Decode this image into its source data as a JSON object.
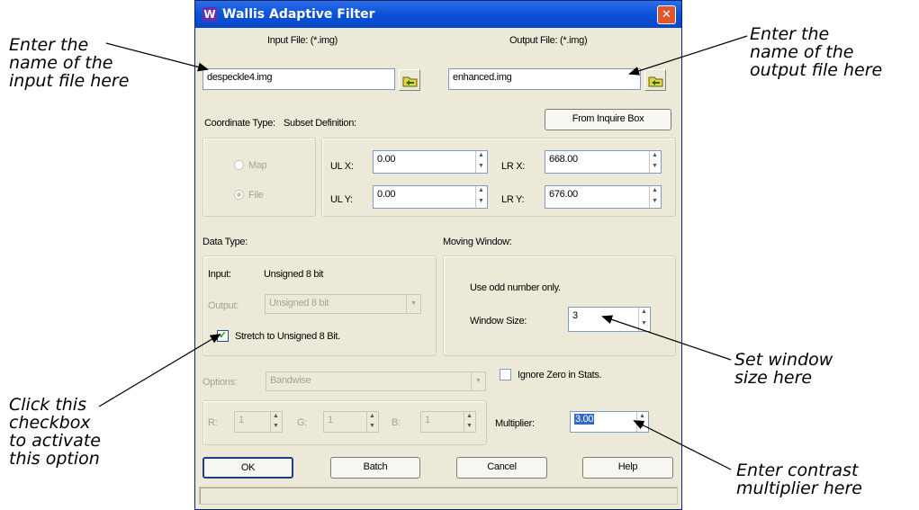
{
  "window": {
    "title": "Wallis Adaptive Filter",
    "close": "✕",
    "icon": "W"
  },
  "input": {
    "label": "Input File: (*.img)",
    "value": "despeckle4.img"
  },
  "output": {
    "label": "Output File: (*.img)",
    "value": "enhanced.img"
  },
  "coordinate": {
    "label": "Coordinate Type:",
    "map": "Map",
    "file": "File"
  },
  "subset": {
    "label": "Subset Definition:",
    "from_inquire": "From Inquire Box",
    "ulx_label": "UL X:",
    "ulx": "0.00",
    "uly_label": "UL Y:",
    "uly": "0.00",
    "lrx_label": "LR X:",
    "lrx": "668.00",
    "lry_label": "LR Y:",
    "lry": "676.00"
  },
  "data_type": {
    "label": "Data Type:",
    "input_label": "Input:",
    "input_value": "Unsigned 8 bit",
    "output_label": "Output:",
    "output_value": "Unsigned 8 bit",
    "stretch": "Stretch to Unsigned 8 Bit."
  },
  "moving_window": {
    "label": "Moving Window:",
    "note": "Use odd number only.",
    "size_label": "Window Size:",
    "size": "3"
  },
  "options": {
    "label": "Options:",
    "value": "Bandwise",
    "ignore_zero": "Ignore Zero in Stats."
  },
  "bands": {
    "r_label": "R:",
    "r": "1",
    "g_label": "G:",
    "g": "1",
    "b_label": "B:",
    "b": "1"
  },
  "multiplier": {
    "label": "Multiplier:",
    "value": "3.00"
  },
  "buttons": {
    "ok": "OK",
    "batch": "Batch",
    "cancel": "Cancel",
    "help": "Help"
  },
  "callouts": {
    "input": "Enter the\nname of the\ninput file here",
    "output": "Enter the\nname of the\noutput file here",
    "window": "Set window\nsize here",
    "checkbox": "Click this\ncheckbox\nto activate\nthis option",
    "multiplier": "Enter contrast\nmultiplier here"
  }
}
